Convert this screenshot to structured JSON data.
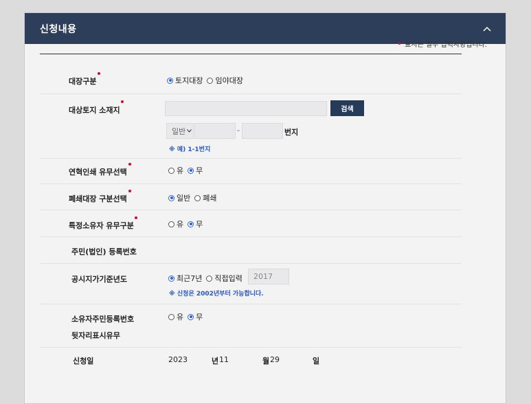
{
  "panel": {
    "title": "신청내용"
  },
  "required_note": "표시는 필수 입력사항입니다.",
  "fields": {
    "ledger_type": {
      "label": "대장구분",
      "options": [
        "토지대장",
        "임야대장"
      ],
      "selected": 0
    },
    "location": {
      "label": "대상토지 소재지",
      "search_label": "검색",
      "lot_type": "일반",
      "beonji_label": "번지",
      "separator": "-",
      "hint": "※ 예) 1-1번지"
    },
    "history_print": {
      "label": "연혁인쇄 유무선택",
      "options": [
        "유",
        "무"
      ],
      "selected": 1
    },
    "closed_ledger": {
      "label": "폐쇄대장 구분선택",
      "options": [
        "일반",
        "폐쇄"
      ],
      "selected": 0
    },
    "specific_owner": {
      "label": "특정소유자 유무구분",
      "options": [
        "유",
        "무"
      ],
      "selected": 1
    },
    "resident_number": {
      "label": "주민(법인) 등록번호"
    },
    "base_year": {
      "label": "공시지가기준년도",
      "options": [
        "최근7년",
        "직접입력"
      ],
      "selected": 0,
      "year_value": "2017",
      "hint": "※ 신청은 2002년부터 가능합니다."
    },
    "owner_rrn_suffix": {
      "label_line1": "소유자주민등록번호",
      "label_line2": "뒷자리표시유무",
      "options": [
        "유",
        "무"
      ],
      "selected": 1
    },
    "apply_date": {
      "label": "신청일",
      "year": "2023",
      "year_unit": "년",
      "month": "11",
      "month_unit": "월",
      "day": "29",
      "day_unit": "일"
    }
  },
  "colors": {
    "header_bg": "#2c3e5a",
    "accent": "#2b5fd9",
    "required": "#c8102e",
    "button_bg": "#263a59",
    "hint": "#2a55b5"
  }
}
